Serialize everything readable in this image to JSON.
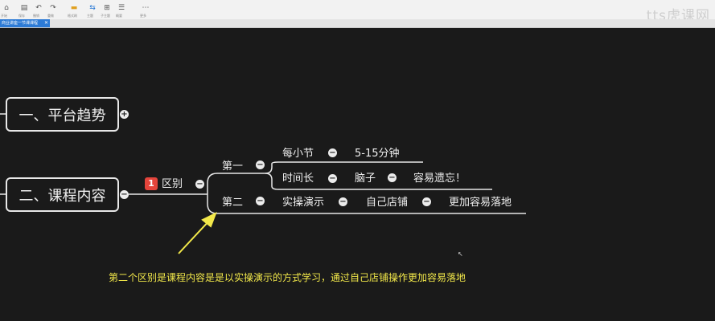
{
  "toolbar": {
    "items": [
      {
        "icon": "⌂",
        "label": "开始"
      },
      {
        "icon": "▤",
        "label": "保存"
      },
      {
        "icon": "↶",
        "label": "撤销"
      },
      {
        "icon": "↷",
        "label": "重做"
      },
      {
        "icon": "▬",
        "label": "格式刷"
      },
      {
        "icon": "⇆",
        "label": "主题"
      },
      {
        "icon": "⊞",
        "label": "子主题"
      },
      {
        "icon": "☰",
        "label": "概要"
      },
      {
        "icon": "⋯",
        "label": "更多"
      }
    ]
  },
  "tab": {
    "label": "商业讲座一节课课程",
    "close": "✕"
  },
  "watermark": "tts虎课网",
  "mindmap": {
    "topic1": "一、平台趋势",
    "topic1_toggle": "+",
    "topic2": "二、课程内容",
    "topic2_toggle": "−",
    "branch": {
      "badge": "1",
      "label": "区别"
    },
    "first": "第一",
    "second": "第二",
    "row1": [
      "每小节",
      "5-15分钟"
    ],
    "row2": [
      "时间长",
      "脑子",
      "容易遗忘！"
    ],
    "row3": [
      "实操演示",
      "自己店铺",
      "更加容易落地"
    ],
    "toggle": "−"
  },
  "caption": "第二个区别是课程内容是是以实操演示的方式学习，通过自己店铺操作更加容易落地",
  "colors": {
    "background": "#1a1a1a",
    "line": "#e8e8e8",
    "caption": "#f2e84a",
    "badge": "#e4443b",
    "tab": "#2d7bd6"
  }
}
